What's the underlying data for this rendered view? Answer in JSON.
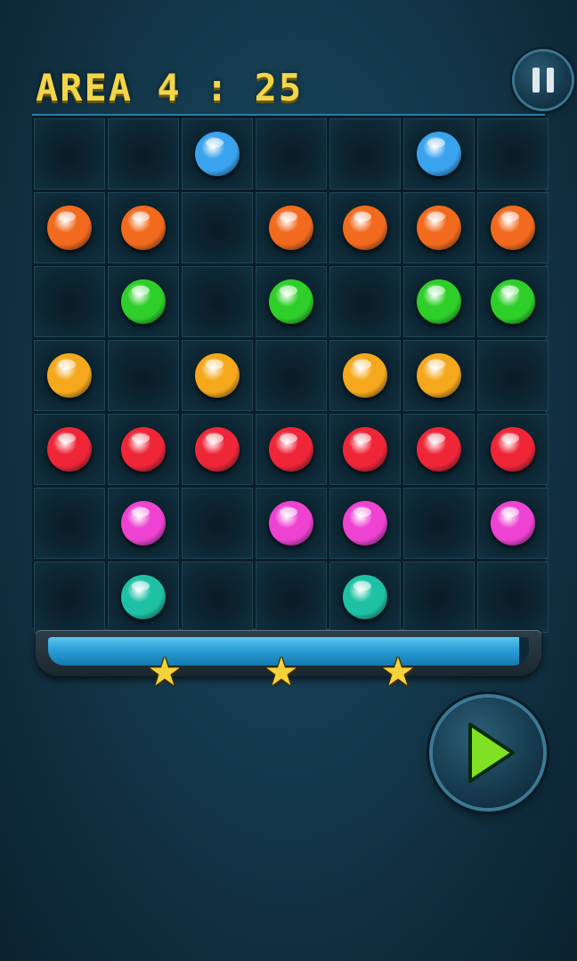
{
  "header": {
    "title": "AREA 4 : 25"
  },
  "colors": {
    "blue": "#3aa3ee",
    "orange": "#f26a1e",
    "green": "#2fcf2a",
    "yellow": "#f5a81c",
    "red": "#ef2638",
    "magenta": "#ee43d2",
    "teal": "#1fc1a5"
  },
  "board": {
    "rows": [
      [
        null,
        null,
        "blue",
        null,
        null,
        "blue",
        null
      ],
      [
        "orange",
        "orange",
        null,
        "orange",
        "orange",
        "orange",
        "orange"
      ],
      [
        null,
        "green",
        null,
        "green",
        null,
        "green",
        "green"
      ],
      [
        "yellow",
        null,
        "yellow",
        null,
        "yellow",
        "yellow",
        null
      ],
      [
        "red",
        "red",
        "red",
        "red",
        "red",
        "red",
        "red"
      ],
      [
        null,
        "magenta",
        null,
        "magenta",
        "magenta",
        null,
        "magenta"
      ],
      [
        null,
        "teal",
        null,
        null,
        "teal",
        null,
        null
      ]
    ]
  },
  "progress": {
    "fill_fraction": 0.98,
    "stars": [
      "★",
      "★",
      "★"
    ]
  },
  "controls": {
    "pause_icon": "pause-icon",
    "play_icon": "play-icon",
    "play_color": "#7fe024"
  }
}
